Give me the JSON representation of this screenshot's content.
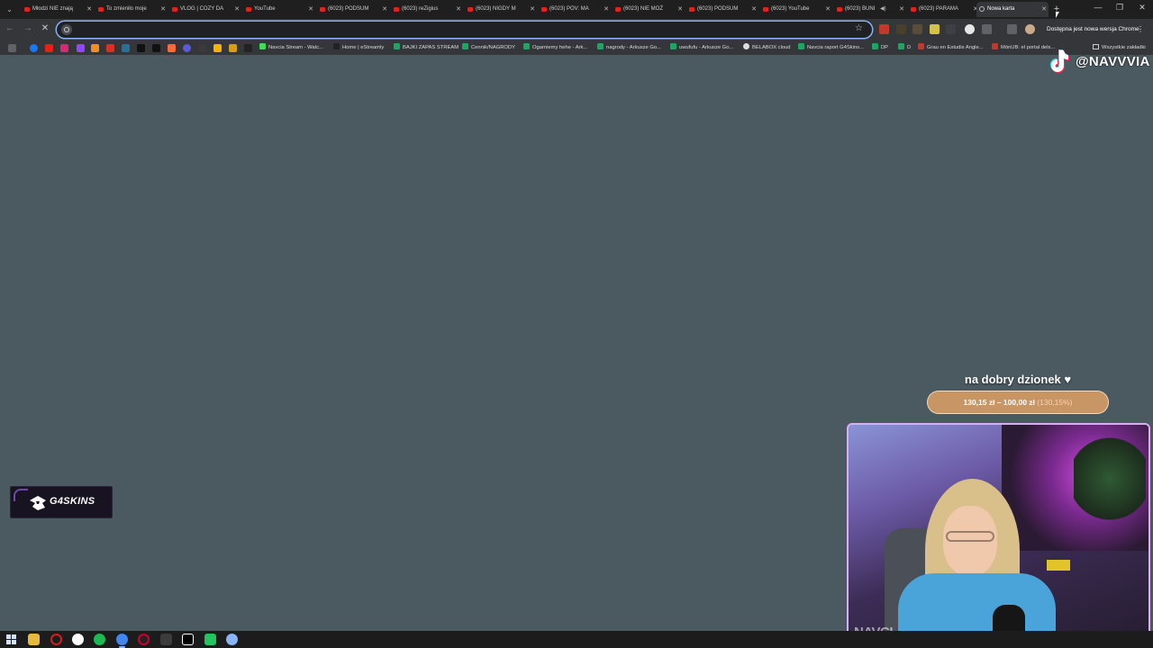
{
  "browser": {
    "tabs": [
      {
        "title": "Młodzi NIE znają",
        "kind": "youtube"
      },
      {
        "title": "To zmieniło moje",
        "kind": "youtube"
      },
      {
        "title": "VLOG | COZY DA",
        "kind": "youtube"
      },
      {
        "title": "YouTube",
        "kind": "youtube"
      },
      {
        "title": "(6023) PODSUM",
        "kind": "youtube"
      },
      {
        "title": "(6023) reZigius",
        "kind": "youtube"
      },
      {
        "title": "(6023) NIGDY M",
        "kind": "youtube"
      },
      {
        "title": "(6023) POV: MA",
        "kind": "youtube"
      },
      {
        "title": "(6023) NIE MOŻ",
        "kind": "youtube"
      },
      {
        "title": "(6023) PODSUM",
        "kind": "youtube"
      },
      {
        "title": "(6023) YouTube",
        "kind": "youtube"
      },
      {
        "title": "(6023) BUNI",
        "kind": "youtube",
        "playing": true
      },
      {
        "title": "(6023) PARAMA",
        "kind": "youtube"
      },
      {
        "title": "Nowa karta",
        "kind": "newtab",
        "active": true
      }
    ],
    "address": {
      "value": "",
      "placeholder": ""
    },
    "update_chip": "Dostępna jest nowa wersja Chrome",
    "bookmarks": [
      {
        "label": "Navcia Stream - Watc...",
        "icon_color": "#3ddc54"
      },
      {
        "label": "Home | eStreamly",
        "icon_color": "#222222"
      },
      {
        "label": "BAJKI ZAPAS STREAM",
        "icon_color": "#1fa463"
      },
      {
        "label": "Cennik/NAGRODY",
        "icon_color": "#1fa463"
      },
      {
        "label": "Ogarniemy hehe - Ark...",
        "icon_color": "#1fa463"
      },
      {
        "label": "nagrody - Arkusze Go...",
        "icon_color": "#1fa463"
      },
      {
        "label": "uwufufu - Arkusze Go...",
        "icon_color": "#1fa463"
      },
      {
        "label": "BELABOX cloud",
        "icon_color": "#dddddd"
      },
      {
        "label": "Navcia raport G4Skins...",
        "icon_color": "#1fa463"
      },
      {
        "label": "DP",
        "icon_color": "#1fa463"
      },
      {
        "label": "D",
        "icon_color": "#1fa463"
      },
      {
        "label": "Grau en Estudis Angle...",
        "icon_color": "#c0392b"
      },
      {
        "label": "MónUB: el portal dels...",
        "icon_color": "#c0392b"
      }
    ],
    "all_bookmarks_label": "Wszystkie zakładki"
  },
  "overlay": {
    "tiktok_handle": "@NAVVVIA",
    "alert_text": "na dobry dzionek ♥",
    "goal": {
      "current": "130,15 zł",
      "target": "100,00 zł",
      "percent_label": "(130,15%)",
      "percent": 130.15
    },
    "cam_tag": "NAVCI",
    "sponsor_text": "G4SKINS"
  },
  "colors": {
    "page_bg": "#4b5a61",
    "tab_bg": "#1f1f1f",
    "toolbar_bg": "#35363a",
    "accent": "#8ab4f8",
    "youtube_red": "#e62117",
    "goal_fill": "#c89565",
    "cam_border": "#d7b0f4"
  }
}
